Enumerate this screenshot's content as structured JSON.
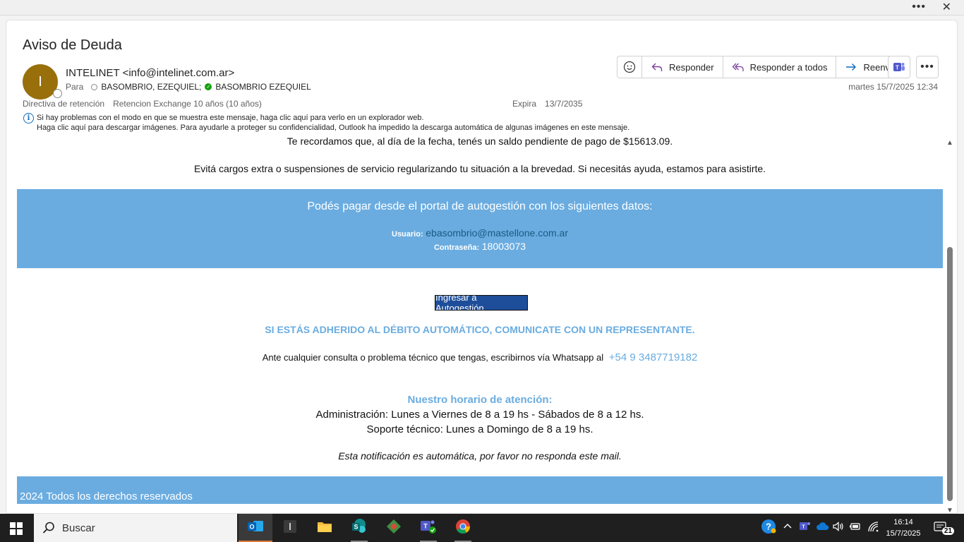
{
  "message": {
    "subject": "Aviso de Deuda",
    "avatar_initial": "I",
    "sender": "INTELINET <info@intelinet.com.ar>",
    "to_label": "Para",
    "recipients": [
      "BASOMBRIO, EZEQUIEL;",
      "BASOMBRIO EZEQUIEL"
    ],
    "retention_label": "Directiva de retención",
    "retention_value": "Retencion Exchange 10 años (10 años)",
    "expires_label": "Expira",
    "expires_value": "13/7/2035",
    "date": "martes 15/7/2025 12:34",
    "info_line1": "Si hay problemas con el modo en que se muestra este mensaje, haga clic aquí para verlo en un explorador web.",
    "info_line2": "Haga clic aquí para descargar imágenes. Para ayudarle a proteger su confidencialidad, Outlook ha impedido la descarga automática de algunas imágenes en este mensaje."
  },
  "actions": {
    "reply": "Responder",
    "reply_all": "Responder a todos",
    "forward": "Reenviar"
  },
  "body": {
    "p1": "Te recordamos que, al día de la fecha, tenés un saldo pendiente de pago de $15613.09.",
    "p2": "Evitá cargos extra o suspensiones de servicio regularizando tu situación a la brevedad. Si necesitás ayuda, estamos para asistirte.",
    "band_title": "Podés pagar desde el portal de autogestión con los siguientes datos:",
    "user_label": "Usuario:",
    "user_value": "ebasombrio@mastellone.com.ar",
    "pass_label": "Contraseña:",
    "pass_value": "18003073",
    "login_button": "Ingresar a Autogestión",
    "warning": "SI ESTÁS ADHERIDO AL DÉBITO AUTOMÁTICO, COMUNICATE CON UN REPRESENTANTE.",
    "whatsapp_text": "Ante cualquier consulta o problema técnico que tengas, escribirnos vía Whatsapp al",
    "whatsapp_number": "+54 9 3487719182",
    "hours_title": "Nuestro horario de atención:",
    "hours_admin": "Administración: Lunes a Viernes de 8 a 19 hs -  Sábados de 8 a 12 hs.",
    "hours_support": "Soporte técnico: Lunes a Domingo de 8 a 19 hs.",
    "note": "Esta notificación es automática, por favor no responda este mail.",
    "footer": "2024 Todos los derechos reservados"
  },
  "taskbar": {
    "search_placeholder": "Buscar",
    "time": "16:14",
    "date": "15/7/2025",
    "notifications": "21"
  },
  "colors": {
    "band": "#6aace0",
    "avatar": "#986f0b",
    "login_button": "#1e4e9a",
    "accent": "#0f6cbd"
  }
}
